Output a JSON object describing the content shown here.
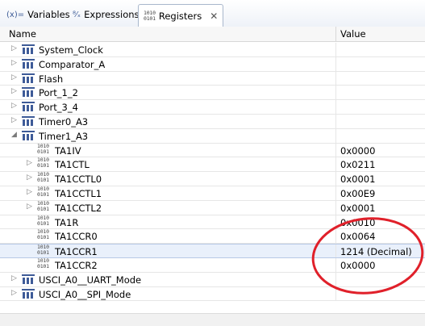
{
  "tabs": [
    {
      "label": "Variables",
      "icon": "(x)="
    },
    {
      "label": "Expressions",
      "icon": "expressions-icon"
    },
    {
      "label": "Registers",
      "icon": "1010\n0101"
    }
  ],
  "columns": {
    "name": "Name",
    "value": "Value"
  },
  "rows": [
    {
      "label": "System_Clock",
      "value": "",
      "expand": "▷",
      "type": "group"
    },
    {
      "label": "Comparator_A",
      "value": "",
      "expand": "▷",
      "type": "group"
    },
    {
      "label": "Flash",
      "value": "",
      "expand": "▷",
      "type": "group"
    },
    {
      "label": "Port_1_2",
      "value": "",
      "expand": "▷",
      "type": "group"
    },
    {
      "label": "Port_3_4",
      "value": "",
      "expand": "▷",
      "type": "group"
    },
    {
      "label": "Timer0_A3",
      "value": "",
      "expand": "▷",
      "type": "group"
    },
    {
      "label": "Timer1_A3",
      "value": "",
      "expand": "◢",
      "type": "group"
    },
    {
      "label": "TA1IV",
      "value": "0x0000",
      "expand": "",
      "type": "reg"
    },
    {
      "label": "TA1CTL",
      "value": "0x0211",
      "expand": "▷",
      "type": "reg"
    },
    {
      "label": "TA1CCTL0",
      "value": "0x0001",
      "expand": "▷",
      "type": "reg"
    },
    {
      "label": "TA1CCTL1",
      "value": "0x00E9",
      "expand": "▷",
      "type": "reg"
    },
    {
      "label": "TA1CCTL2",
      "value": "0x0001",
      "expand": "▷",
      "type": "reg"
    },
    {
      "label": "TA1R",
      "value": "0x0010",
      "expand": "",
      "type": "reg"
    },
    {
      "label": "TA1CCR0",
      "value": "0x0064",
      "expand": "",
      "type": "reg"
    },
    {
      "label": "TA1CCR1",
      "value": "1214 (Decimal)",
      "expand": "",
      "type": "reg",
      "selected": true
    },
    {
      "label": "TA1CCR2",
      "value": "0x0000",
      "expand": "",
      "type": "reg"
    },
    {
      "label": "USCI_A0__UART_Mode",
      "value": "",
      "expand": "▷",
      "type": "group"
    },
    {
      "label": "USCI_A0__SPI_Mode",
      "value": "",
      "expand": "▷",
      "type": "group"
    }
  ],
  "colors": {
    "annotation": "#e0202a",
    "selection": "#e9f0fb"
  }
}
